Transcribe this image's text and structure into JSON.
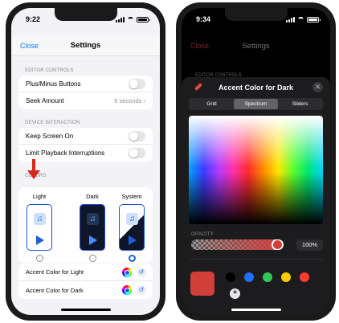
{
  "left_phone": {
    "status": {
      "time": "9:22"
    },
    "nav": {
      "close": "Close",
      "title": "Settings"
    },
    "editor_controls": {
      "header": "EDITOR CONTROLS",
      "plus_minus": "Plus/Minus Buttons",
      "seek_amount": "Seek Amount",
      "seek_value": "5 seconds"
    },
    "device_interaction": {
      "header": "DEVICE INTERACTION",
      "keep_screen_on": "Keep Screen On",
      "limit_playback": "Limit Playback Interruptions"
    },
    "colors": {
      "header": "COLORS",
      "light_label": "Light",
      "dark_label": "Dark",
      "system_label": "System",
      "selected": "System",
      "accent_light": "Accent Color for Light",
      "accent_dark": "Accent Color for Dark"
    },
    "icons": {
      "note": "♫",
      "reset": "↺",
      "arrow": "red-down-arrow"
    }
  },
  "right_phone": {
    "status": {
      "time": "9:34"
    },
    "nav": {
      "close": "Close",
      "title": "Settings"
    },
    "editor_header": "EDITOR CONTROLS",
    "picker": {
      "title": "Accent Color for Dark",
      "close": "✕",
      "tabs": [
        "Grid",
        "Spectrum",
        "Sliders"
      ],
      "active_tab": "Spectrum",
      "opacity_label": "OPACITY",
      "opacity_value": "100%",
      "opacity_fraction": 1.0,
      "current_color": "#d23e3a",
      "presets": [
        "#000000",
        "#1f6fff",
        "#34c759",
        "#ffcc00",
        "#ff3b30"
      ],
      "add": "+"
    }
  },
  "colors": {
    "accent_blue": "#007aff",
    "dark_bg": "#1c1c1e",
    "red_arrow": "#d62718"
  }
}
